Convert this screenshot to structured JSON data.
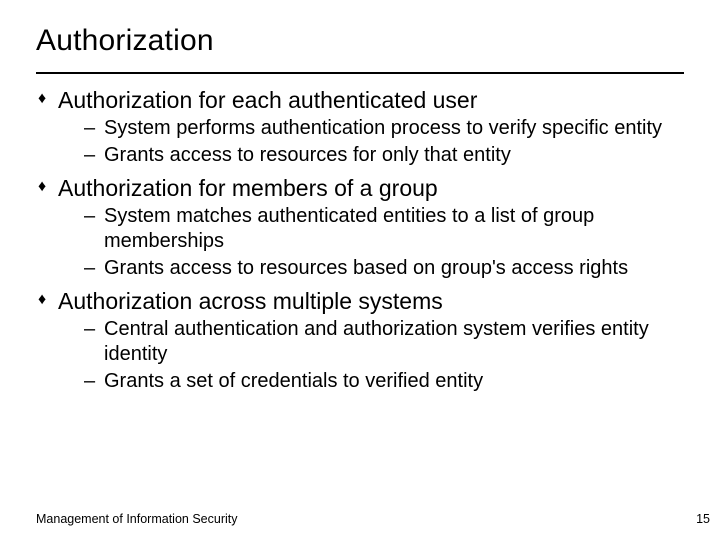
{
  "title": "Authorization",
  "bullets": [
    {
      "text": "Authorization for each authenticated user",
      "subs": [
        "System performs authentication process to verify specific entity",
        "Grants access to resources for only that entity"
      ]
    },
    {
      "text": "Authorization for members of a group",
      "subs": [
        "System matches authenticated entities to a list of group memberships",
        "Grants access to resources based on group's access rights"
      ]
    },
    {
      "text": "Authorization across multiple systems",
      "subs": [
        "Central authentication and authorization system verifies entity identity",
        "Grants a set of credentials to verified entity"
      ]
    }
  ],
  "footer_left": "Management of Information Security",
  "footer_right": "15",
  "glyphs": {
    "diamond": "♦",
    "dash": "–"
  }
}
